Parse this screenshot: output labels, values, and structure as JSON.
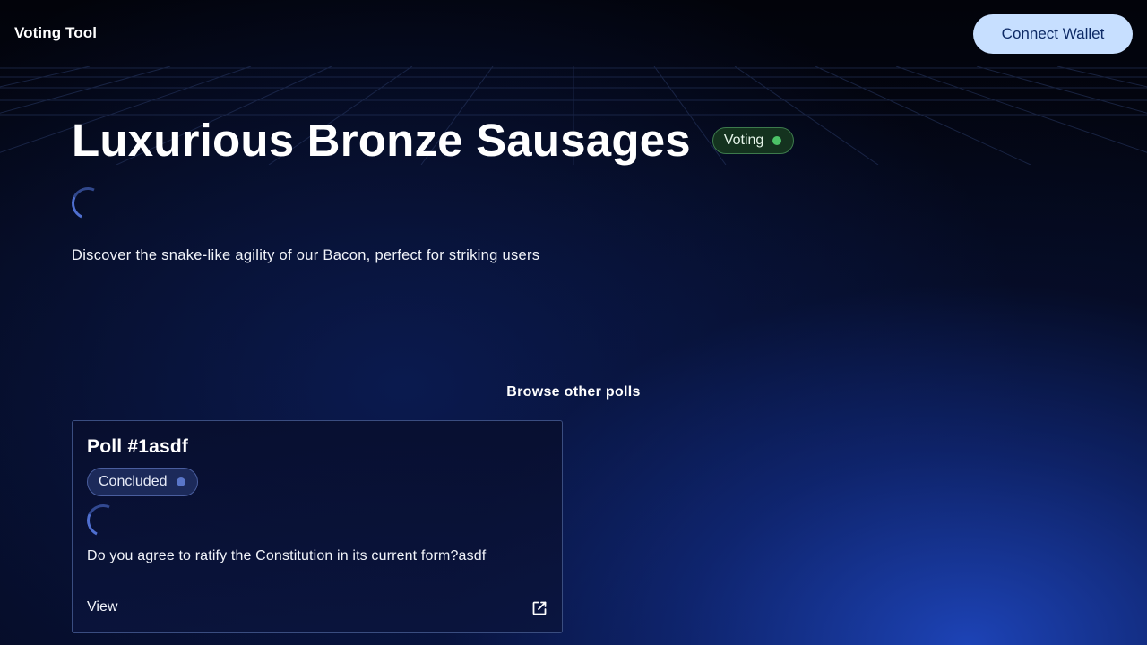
{
  "header": {
    "app_title": "Voting Tool",
    "connect_wallet_label": "Connect Wallet"
  },
  "poll": {
    "title": "Luxurious Bronze Sausages",
    "status": "Voting",
    "description": "Discover the snake-like agility of our Bacon, perfect for striking users"
  },
  "browse": {
    "heading": "Browse other polls",
    "polls": [
      {
        "title": "Poll #1asdf",
        "status": "Concluded",
        "question": "Do you agree to ratify the Constitution in its current form?asdf",
        "view_label": "View"
      }
    ]
  },
  "colors": {
    "accent": "#c7dfff",
    "voting_status": "#4cc267",
    "concluded_status": "#5a76c8",
    "background": "#02040c"
  },
  "icons": {
    "loading": "spinner-icon",
    "external_link": "external-link-icon",
    "status_dot": "status-dot-icon"
  }
}
